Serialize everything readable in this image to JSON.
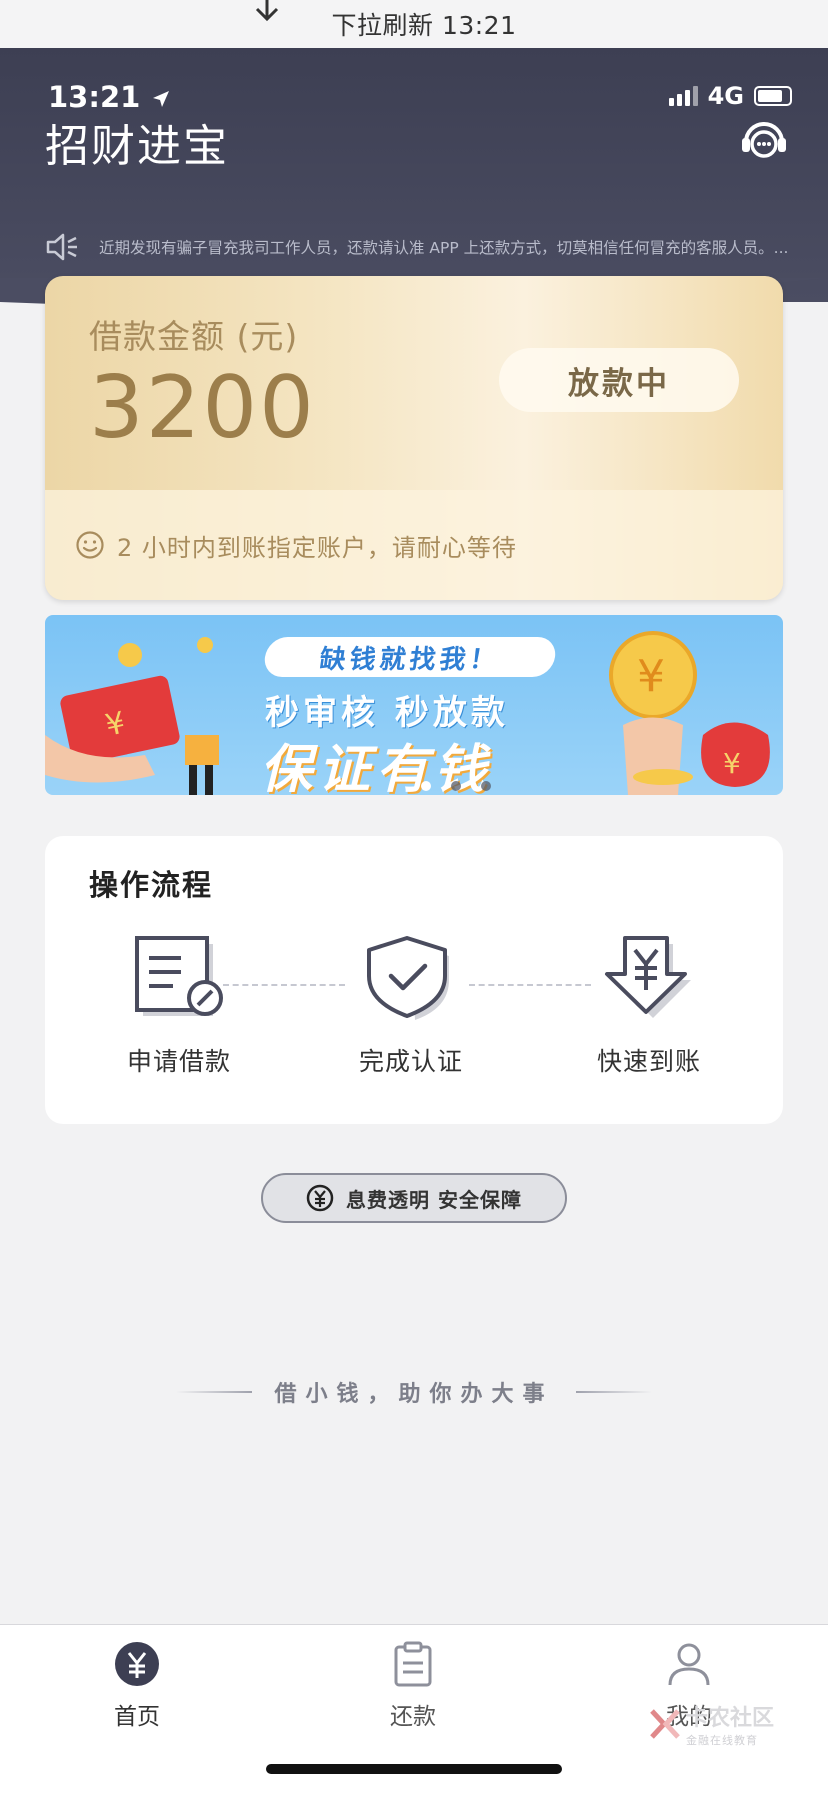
{
  "pull_refresh": {
    "text": "下拉刷新 13:21"
  },
  "status_bar": {
    "time": "13:21",
    "network": "4G"
  },
  "header": {
    "title": "招财进宝",
    "notice": "近期发现有骗子冒充我司工作人员，还款请认准 APP 上还款方式，切莫相信任何冒充的客服人员。..."
  },
  "loan_card": {
    "label": "借款金额 (元)",
    "amount": "3200",
    "status": "放款中",
    "tip": "2 小时内到账指定账户，请耐心等待"
  },
  "banner": {
    "tag": "缺钱就找我！",
    "subtitle": "秒审核 秒放款",
    "headline": "保证有钱",
    "page_count": 3,
    "active_index": 0
  },
  "process": {
    "title": "操作流程",
    "steps": [
      {
        "label": "申请借款",
        "icon": "document-edit-icon"
      },
      {
        "label": "完成认证",
        "icon": "shield-check-icon"
      },
      {
        "label": "快速到账",
        "icon": "yen-arrow-icon"
      }
    ]
  },
  "fee_badge": {
    "text": "息费透明 安全保障"
  },
  "slogan": "借小钱，助你办大事",
  "tabbar": {
    "items": [
      {
        "label": "首页",
        "icon": "yen-circle-icon",
        "active": true
      },
      {
        "label": "还款",
        "icon": "clipboard-icon",
        "active": false
      },
      {
        "label": "我的",
        "icon": "user-icon",
        "active": false
      }
    ]
  },
  "watermark": {
    "main": "卡农社区",
    "sub": "金融在线教育"
  },
  "colors": {
    "header_dark": "#3d3f53",
    "gold_text": "#a88c5d",
    "banner_blue": "#7bc3f5"
  }
}
